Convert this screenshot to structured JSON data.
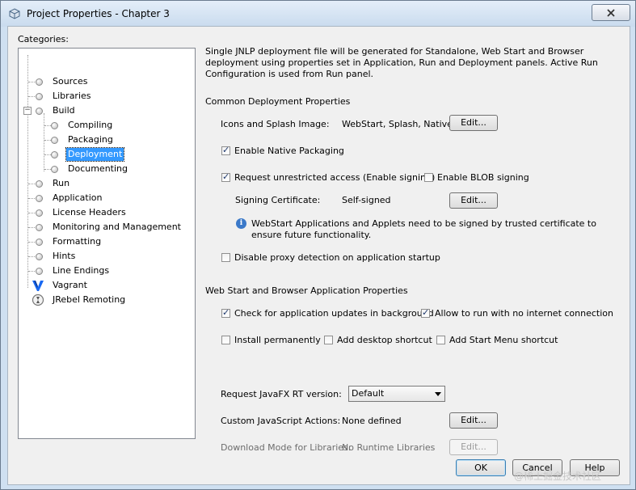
{
  "window": {
    "title": "Project Properties - Chapter 3",
    "close_icon": "close-icon"
  },
  "categories": {
    "label": "Categories:",
    "items": [
      {
        "label": "Sources",
        "level": 0
      },
      {
        "label": "Libraries",
        "level": 0
      },
      {
        "label": "Build",
        "level": 0,
        "expander": "−"
      },
      {
        "label": "Compiling",
        "level": 1
      },
      {
        "label": "Packaging",
        "level": 1
      },
      {
        "label": "Deployment",
        "level": 1,
        "selected": true
      },
      {
        "label": "Documenting",
        "level": 1
      },
      {
        "label": "Run",
        "level": 0
      },
      {
        "label": "Application",
        "level": 0
      },
      {
        "label": "License Headers",
        "level": 0
      },
      {
        "label": "Monitoring and Management",
        "level": 0
      },
      {
        "label": "Formatting",
        "level": 0
      },
      {
        "label": "Hints",
        "level": 0
      },
      {
        "label": "Line Endings",
        "level": 0
      },
      {
        "label": "Vagrant",
        "level": 0,
        "icon": "vagrant-icon"
      },
      {
        "label": "JRebel Remoting",
        "level": 0,
        "icon": "jrebel-icon"
      }
    ]
  },
  "panel": {
    "description": "Single JNLP deployment file will be generated for Standalone, Web Start and Browser deployment using properties set in Application, Run and Deployment panels. Active Run Configuration is used from Run panel.",
    "common_section": "Common Deployment Properties",
    "icons_label": "Icons and Splash Image:",
    "icons_value": "WebStart, Splash, Native",
    "edit_label": "Edit...",
    "enable_native": "Enable Native Packaging",
    "request_unrestricted": "Request unrestricted access (Enable signing)",
    "enable_blob": "Enable BLOB signing",
    "signing_label": "Signing Certificate:",
    "signing_value": "Self-signed",
    "signing_info": "WebStart Applications and Applets need to be signed by trusted certificate to ensure future functionality.",
    "disable_proxy": "Disable proxy detection on application startup",
    "webstart_section": "Web Start and Browser Application Properties",
    "check_updates": "Check for application updates in background",
    "allow_offline": "Allow to run with no internet connection",
    "install_perm": "Install permanently",
    "add_desktop": "Add desktop shortcut",
    "add_start_menu": "Add Start Menu shortcut",
    "javafx_label": "Request JavaFX RT version:",
    "javafx_value": "Default",
    "js_label": "Custom JavaScript Actions:",
    "js_value": "None defined",
    "download_label": "Download Mode for Libraries:",
    "download_value": "No Runtime Libraries"
  },
  "footer": {
    "ok": "OK",
    "cancel": "Cancel",
    "help": "Help"
  },
  "watermark": "@稀土掘金技术社区"
}
